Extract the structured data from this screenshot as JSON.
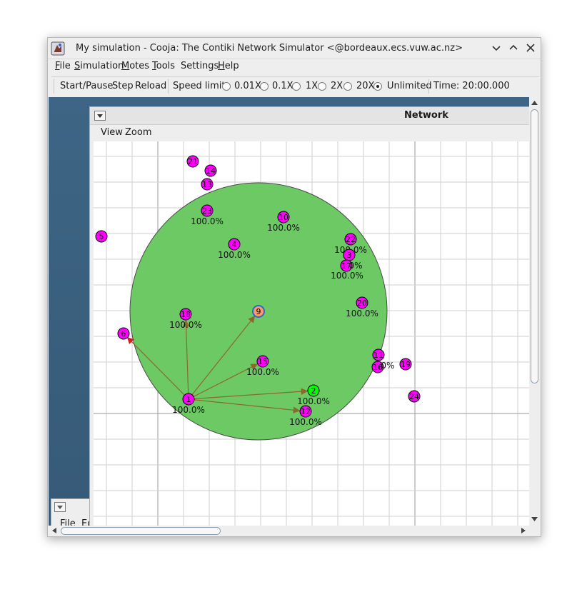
{
  "window": {
    "title": "My simulation - Cooja: The Contiki Network Simulator <@bordeaux.ecs.vuw.ac.nz>",
    "app_icon": "cooja-app-icon",
    "controls": [
      "chevron-down-icon",
      "chevron-up-icon",
      "close-icon"
    ]
  },
  "menubar": {
    "items": [
      "File",
      "Simulation",
      "Motes",
      "Tools",
      "Settings",
      "Help"
    ],
    "mnemonics": [
      "F",
      "S",
      "M",
      "T",
      "",
      "H"
    ]
  },
  "toolbar": {
    "start_pause": "Start/Pause",
    "step": "Step",
    "reload": "Reload",
    "speed_limit_label": "Speed limit:",
    "speed_options": [
      "0.01X",
      "0.1X",
      "1X",
      "2X",
      "20X",
      "Unlimited"
    ],
    "selected_speed": "Unlimited",
    "time": "Time: 20:00.000"
  },
  "network_window": {
    "title": "Network",
    "menu": [
      "View",
      "Zoom"
    ],
    "range_color": "#6cc964",
    "mote_color": "#ff00ff",
    "selected_mote_color": "#ff9966",
    "receiving_mote_color": "#00ff00",
    "arrow_color": "#8a6a2a",
    "motes": [
      {
        "id": "21",
        "label": ""
      },
      {
        "id": "14",
        "label": ""
      },
      {
        "id": "13",
        "label": ""
      },
      {
        "id": "23",
        "label": "100.0%"
      },
      {
        "id": "10",
        "label": "100.0%"
      },
      {
        "id": "5",
        "label": ""
      },
      {
        "id": "4",
        "label": "100.0%"
      },
      {
        "id": "22",
        "label": "100.0%"
      },
      {
        "id": "3",
        "label": ""
      },
      {
        "id": "17",
        "label": "0%"
      },
      {
        "id": "",
        "label": "100.0%"
      },
      {
        "id": "9",
        "label": "",
        "selected": true
      },
      {
        "id": "20",
        "label": "100.0%"
      },
      {
        "id": "18",
        "label": "100.0%"
      },
      {
        "id": "6",
        "label": ""
      },
      {
        "id": "11",
        "label": ""
      },
      {
        "id": "16",
        "label": ".0%"
      },
      {
        "id": "19",
        "label": ""
      },
      {
        "id": "15",
        "label": "100.0%"
      },
      {
        "id": "2",
        "label": "100.0%",
        "receiving": true
      },
      {
        "id": "24",
        "label": ""
      },
      {
        "id": "1",
        "label": "100.0%"
      },
      {
        "id": "12",
        "label": "100.0%"
      }
    ]
  },
  "background_window": {
    "menu_partial": "File  Ed"
  }
}
